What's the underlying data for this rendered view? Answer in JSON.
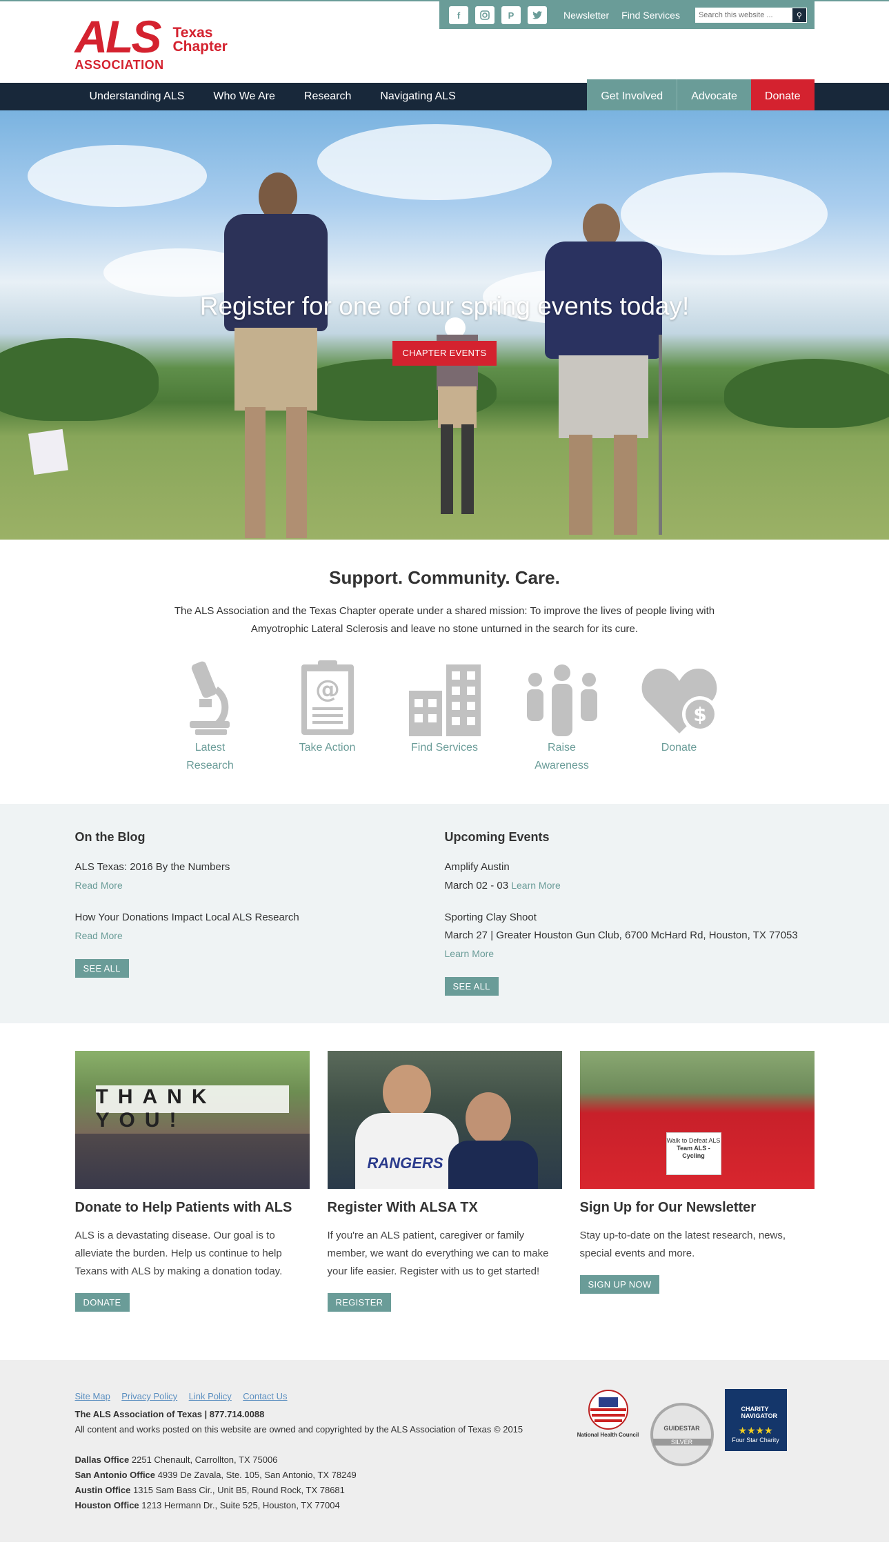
{
  "header": {
    "logo_als": "ALS",
    "logo_chapter_line1": "Texas",
    "logo_chapter_line2": "Chapter",
    "logo_assoc": "ASSOCIATION",
    "util_links": [
      "Newsletter",
      "Find Services"
    ],
    "search_placeholder": "Search this website ..."
  },
  "nav": {
    "items": [
      "Understanding ALS",
      "Who We Are",
      "Research",
      "Navigating ALS"
    ],
    "right": [
      "Get Involved",
      "Advocate",
      "Donate"
    ]
  },
  "hero": {
    "title": "Register for one of our spring events today!",
    "button": "CHAPTER EVENTS"
  },
  "intro": {
    "title": "Support. Community. Care.",
    "text": "The ALS Association and the Texas Chapter operate under a shared mission: To improve the lives of people living with Amyotrophic Lateral Sclerosis and leave no stone unturned in the search for its cure.",
    "features": [
      {
        "label": "Latest Research",
        "icon": "microscope-icon"
      },
      {
        "label": "Take Action",
        "icon": "clipboard-icon"
      },
      {
        "label": "Find Services",
        "icon": "building-icon"
      },
      {
        "label": "Raise Awareness",
        "icon": "people-icon"
      },
      {
        "label": "Donate",
        "icon": "heart-dollar-icon"
      }
    ]
  },
  "blog": {
    "title": "On the Blog",
    "posts": [
      {
        "title": "ALS Texas: 2016 By the Numbers",
        "more": "Read More"
      },
      {
        "title": "How Your Donations Impact Local ALS Research",
        "more": "Read More"
      }
    ],
    "see_all": "SEE ALL"
  },
  "events": {
    "title": "Upcoming Events",
    "items": [
      {
        "name": "Amplify Austin",
        "detail": "March 02 - 03",
        "more": "Learn More"
      },
      {
        "name": "Sporting Clay Shoot",
        "detail": "March 27 | Greater Houston Gun Club, 6700 McHard Rd, Houston, TX 77053",
        "more": "Learn More"
      }
    ],
    "see_all": "SEE ALL"
  },
  "cards": [
    {
      "title": "Donate to Help Patients with ALS",
      "text": "ALS is a devastating disease. Our goal is to alleviate the burden. Help us continue to help Texans with ALS by making a donation today.",
      "button": "DONATE"
    },
    {
      "title": "Register With ALSA TX",
      "text": "If you're an ALS patient, caregiver or family member, we want do everything we can to make your life easier. Register with us to get started!",
      "button": "REGISTER"
    },
    {
      "title": "Sign Up for Our Newsletter",
      "text": "Stay up-to-date on the latest research, news, special events and more.",
      "button": "SIGN UP NOW"
    }
  ],
  "card_images": {
    "thank_you_signs": "THANK YOU!",
    "rangers_shirt": "RANGERS",
    "walk_sign": "Walk to Defeat ALS",
    "team_sign": "Team ALS - Cycling"
  },
  "footer": {
    "links": [
      "Site Map",
      "Privacy Policy",
      "Link Policy",
      "Contact Us"
    ],
    "org": "The ALS Association of Texas | 877.714.0088",
    "copyright": "All content and works posted on this website are owned and copyrighted by the ALS Association of Texas © 2015",
    "offices": [
      {
        "name": "Dallas Office",
        "addr": "2251 Chenault, Carrollton, TX 75006"
      },
      {
        "name": "San Antonio Office",
        "addr": "4939 De Zavala, Ste. 105, San Antonio, TX 78249"
      },
      {
        "name": "Austin Office",
        "addr": "1315 Sam Bass Cir., Unit B5, Round Rock, TX 78681"
      },
      {
        "name": "Houston Office",
        "addr": "1213 Hermann Dr., Suite 525, Houston, TX 77004"
      }
    ],
    "badge_charity": "CHARITY NAVIGATOR",
    "badge_charity_sub": "Four Star Charity",
    "badge_guidestar": "GUIDESTAR",
    "badge_guidestar_sub": "SILVER",
    "badge_nhc": "National Health Council"
  },
  "colors": {
    "red": "#d4222f",
    "teal": "#6a9c98",
    "navy": "#18283a"
  }
}
